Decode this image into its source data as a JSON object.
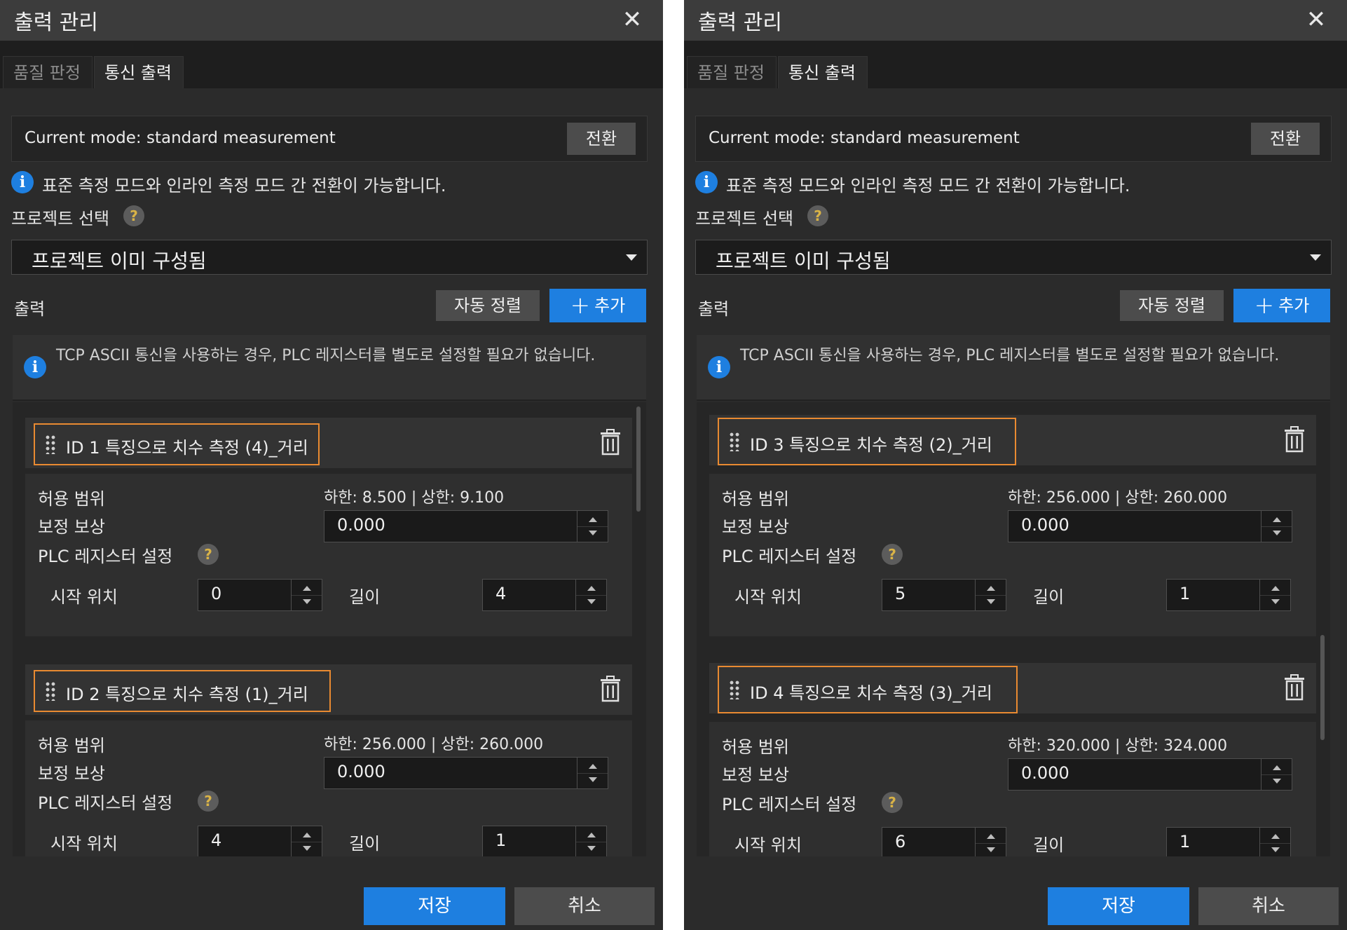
{
  "dialog_title": "출력 관리",
  "close_glyph": "✕",
  "tabs": [
    "품질 판정",
    "통신 출력"
  ],
  "mode_text": "Current mode: standard measurement",
  "switch_label": "전환",
  "info_glyph": "i",
  "help_glyph": "?",
  "info_text": "표준 측정 모드와 인라인 측정 모드 간 전환이 가능합니다.",
  "project_label": "프로젝트 선택",
  "project_value": "프로젝트 이미 구성됨",
  "output_label": "출력",
  "autosort_label": "자동 정렬",
  "add_plus": "+",
  "add_label": "추가",
  "notice_text": "TCP ASCII 통신을 사용하는 경우, PLC 레지스터를 별도로 설정할 필요가 없습니다.",
  "labels": {
    "tolerance": "허용 범위",
    "compensation": "보정 보상",
    "plc": "PLC 레지스터 설정",
    "start": "시작 위치",
    "length": "길이"
  },
  "save_label": "저장",
  "cancel_label": "취소",
  "panels": [
    {
      "items": [
        {
          "title": "ID 1  특징으로 치수 측정 (4)_거리",
          "range": "하한: 8.500 | 상한: 9.100",
          "compensation": "0.000",
          "start": "0",
          "length": "4"
        },
        {
          "title": "ID 2  특징으로 치수 측정 (1)_거리",
          "range": "하한: 256.000 | 상한: 260.000",
          "compensation": "0.000",
          "start": "4",
          "length": "1"
        }
      ]
    },
    {
      "items": [
        {
          "title": "ID 3  특징으로 치수 측정 (2)_거리",
          "range": "하한: 256.000 | 상한: 260.000",
          "compensation": "0.000",
          "start": "5",
          "length": "1"
        },
        {
          "title": "ID 4  특징으로 치수 측정 (3)_거리",
          "range": "하한: 320.000 | 상한: 324.000",
          "compensation": "0.000",
          "start": "6",
          "length": "1"
        }
      ]
    }
  ],
  "colors": {
    "accent": "#1e7fe0",
    "highlight_outline": "#e98a31",
    "background": "#2b2b2b"
  }
}
